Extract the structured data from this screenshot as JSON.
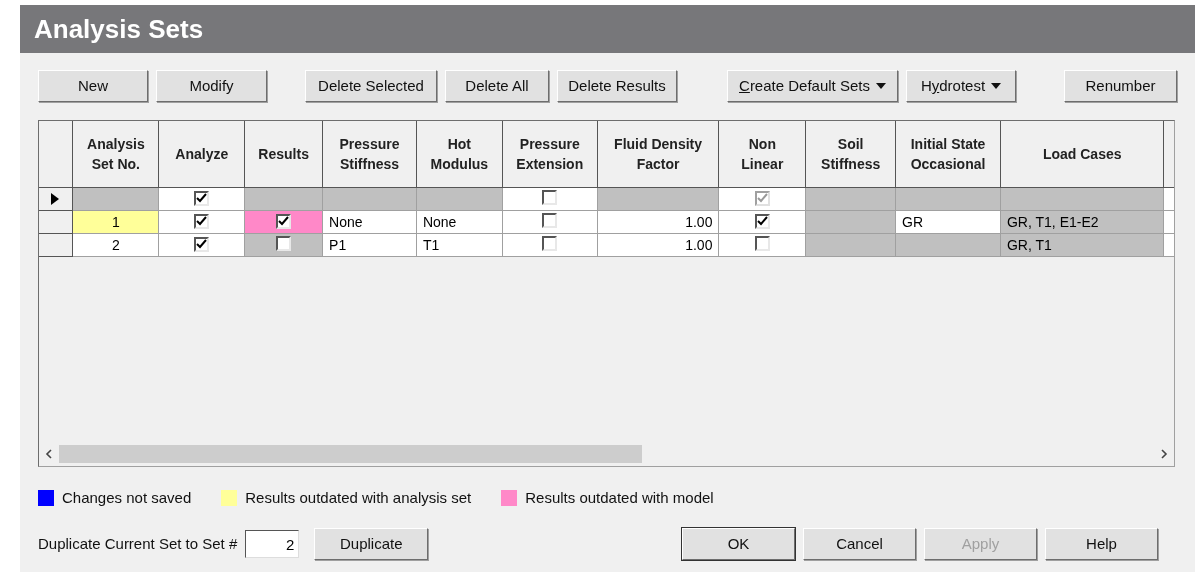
{
  "title": "Analysis Sets",
  "toolbar": [
    {
      "label": "New",
      "menu": false
    },
    {
      "label": "Modify",
      "menu": false
    },
    {
      "label": "Delete Selected",
      "menu": false
    },
    {
      "label": "Delete All",
      "menu": false
    },
    {
      "label": "Delete Results",
      "menu": false
    },
    {
      "access_key": "C",
      "label": "reate Default Sets",
      "menu": true
    },
    {
      "label_before": "H",
      "access_key": "y",
      "label": "drotest",
      "menu": true
    },
    {
      "label": "Renumber",
      "menu": false
    }
  ],
  "table": {
    "columns": [
      "Analysis Set No.",
      "Analyze",
      "Results",
      "Pressure Stiffness",
      "Hot Modulus",
      "Pressure Extension",
      "Fluid Density Factor",
      "Non Linear",
      "Soil Stiffness",
      "Initial State Occasional",
      "Load Cases"
    ],
    "rows": [
      {
        "current": true,
        "cells": [
          {
            "kind": "text",
            "text": "",
            "color": "#c0c0c0"
          },
          {
            "kind": "check",
            "checked": true,
            "disabled": false,
            "color": "#ffffff"
          },
          {
            "kind": "text",
            "text": "",
            "color": "#c0c0c0"
          },
          {
            "kind": "text",
            "text": "",
            "color": "#c0c0c0"
          },
          {
            "kind": "text",
            "text": "",
            "color": "#c0c0c0"
          },
          {
            "kind": "check",
            "checked": false,
            "disabled": false,
            "color": "#ffffff"
          },
          {
            "kind": "text",
            "text": "",
            "color": "#c0c0c0"
          },
          {
            "kind": "check",
            "checked": true,
            "disabled": true,
            "color": "#ffffff"
          },
          {
            "kind": "text",
            "text": "",
            "color": "#c0c0c0"
          },
          {
            "kind": "text",
            "text": "",
            "color": "#c0c0c0"
          },
          {
            "kind": "text",
            "text": "",
            "color": "#c0c0c0"
          }
        ]
      },
      {
        "current": false,
        "cells": [
          {
            "kind": "number",
            "text": "1",
            "color": "#ffff99"
          },
          {
            "kind": "check",
            "checked": true,
            "disabled": false,
            "color": "#ffffff"
          },
          {
            "kind": "check",
            "checked": true,
            "disabled": false,
            "color": "#ff88c8"
          },
          {
            "kind": "text",
            "text": "None",
            "color": "#ffffff"
          },
          {
            "kind": "text",
            "text": "None",
            "color": "#ffffff"
          },
          {
            "kind": "check",
            "checked": false,
            "disabled": false,
            "color": "#ffffff"
          },
          {
            "kind": "value",
            "text": "1.00",
            "color": "#ffffff"
          },
          {
            "kind": "check",
            "checked": true,
            "disabled": false,
            "color": "#ffffff"
          },
          {
            "kind": "text",
            "text": "",
            "color": "#c0c0c0"
          },
          {
            "kind": "text",
            "text": "GR",
            "color": "#ffffff"
          },
          {
            "kind": "text",
            "text": "GR, T1, E1-E2",
            "color": "#c0c0c0"
          }
        ]
      },
      {
        "current": false,
        "cells": [
          {
            "kind": "number",
            "text": "2",
            "color": "#ffffff"
          },
          {
            "kind": "check",
            "checked": true,
            "disabled": false,
            "color": "#ffffff"
          },
          {
            "kind": "check",
            "checked": false,
            "disabled": false,
            "color": "#c0c0c0"
          },
          {
            "kind": "text",
            "text": "P1",
            "color": "#ffffff"
          },
          {
            "kind": "text",
            "text": "T1",
            "color": "#ffffff"
          },
          {
            "kind": "check",
            "checked": false,
            "disabled": false,
            "color": "#ffffff"
          },
          {
            "kind": "value",
            "text": "1.00",
            "color": "#ffffff"
          },
          {
            "kind": "check",
            "checked": false,
            "disabled": false,
            "color": "#ffffff"
          },
          {
            "kind": "text",
            "text": "",
            "color": "#c0c0c0"
          },
          {
            "kind": "text",
            "text": "",
            "color": "#c0c0c0"
          },
          {
            "kind": "text",
            "text": "GR, T1",
            "color": "#c0c0c0"
          }
        ]
      }
    ]
  },
  "legend": [
    {
      "label": "Changes not saved",
      "color": "#0000ff"
    },
    {
      "label": "Results outdated with analysis set",
      "color": "#ffff99"
    },
    {
      "label": "Results outdated with model",
      "color": "#ff88c8"
    }
  ],
  "duplicate": {
    "label": "Duplicate Current Set to Set #",
    "value": "2",
    "button": "Duplicate"
  },
  "actions": [
    {
      "label": "OK",
      "default": true,
      "disabled": false
    },
    {
      "label": "Cancel",
      "default": false,
      "disabled": false
    },
    {
      "label": "Apply",
      "default": false,
      "disabled": true
    },
    {
      "label": "Help",
      "default": false,
      "disabled": false
    }
  ]
}
